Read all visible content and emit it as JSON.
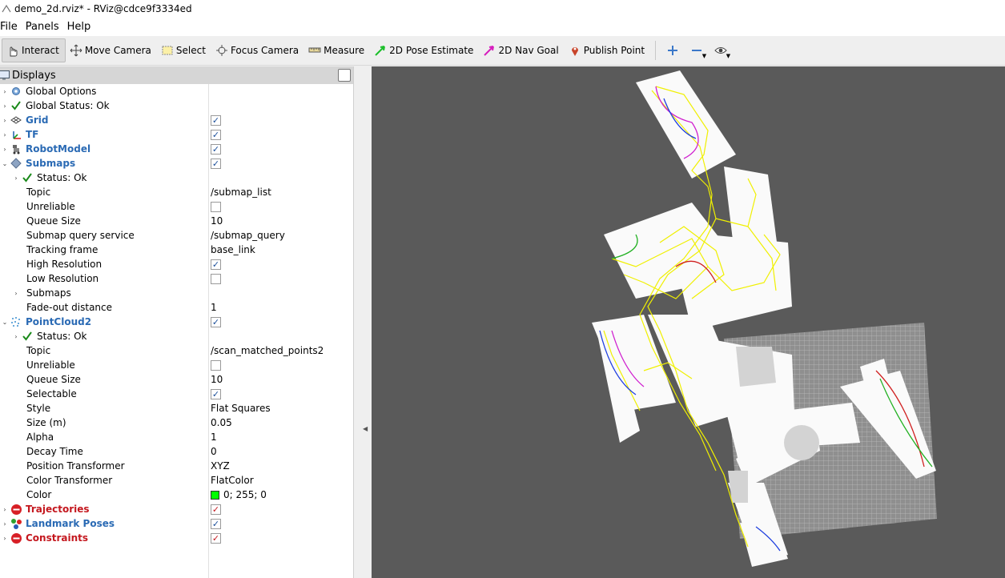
{
  "window": {
    "title": "demo_2d.rviz* - RViz@cdce9f3334ed"
  },
  "menu": {
    "file": "File",
    "panels": "Panels",
    "help": "Help"
  },
  "toolbar": {
    "interact": "Interact",
    "move_camera": "Move Camera",
    "select": "Select",
    "focus_camera": "Focus Camera",
    "measure": "Measure",
    "pose_estimate": "2D Pose Estimate",
    "nav_goal": "2D Nav Goal",
    "publish_point": "Publish Point"
  },
  "displays": {
    "header": "Displays",
    "global_options": "Global Options",
    "global_status": "Global Status: Ok",
    "grid": {
      "label": "Grid",
      "checked": true
    },
    "tf": {
      "label": "TF",
      "checked": true
    },
    "robot_model": {
      "label": "RobotModel",
      "checked": true
    },
    "submaps": {
      "label": "Submaps",
      "checked": true,
      "status": "Status: Ok",
      "props": [
        {
          "name": "Topic",
          "value": "/submap_list"
        },
        {
          "name": "Unreliable",
          "checkbox": false
        },
        {
          "name": "Queue Size",
          "value": "10"
        },
        {
          "name": "Submap query service",
          "value": "/submap_query"
        },
        {
          "name": "Tracking frame",
          "value": "base_link"
        },
        {
          "name": "High Resolution",
          "checkbox": true
        },
        {
          "name": "Low Resolution",
          "checkbox": false
        },
        {
          "name": "Submaps",
          "expandable": true
        },
        {
          "name": "Fade-out distance",
          "value": "1"
        }
      ]
    },
    "pointcloud2": {
      "label": "PointCloud2",
      "checked": true,
      "status": "Status: Ok",
      "props": [
        {
          "name": "Topic",
          "value": "/scan_matched_points2"
        },
        {
          "name": "Unreliable",
          "checkbox": false
        },
        {
          "name": "Queue Size",
          "value": "10"
        },
        {
          "name": "Selectable",
          "checkbox": true
        },
        {
          "name": "Style",
          "value": "Flat Squares"
        },
        {
          "name": "Size (m)",
          "value": "0.05"
        },
        {
          "name": "Alpha",
          "value": "1"
        },
        {
          "name": "Decay Time",
          "value": "0"
        },
        {
          "name": "Position Transformer",
          "value": "XYZ"
        },
        {
          "name": "Color Transformer",
          "value": "FlatColor"
        },
        {
          "name": "Color",
          "value": "0; 255; 0",
          "swatch": "#00ff00"
        }
      ]
    },
    "trajectories": {
      "label": "Trajectories",
      "checked": true
    },
    "landmark_poses": {
      "label": "Landmark Poses",
      "checked": true
    },
    "constraints": {
      "label": "Constraints",
      "checked": true
    }
  },
  "colors": {
    "viewport_bg": "#5a5a5a",
    "link_blue": "#2a6ab4",
    "error_red": "#c4181f",
    "grid_cell": "#c8c8c8"
  }
}
